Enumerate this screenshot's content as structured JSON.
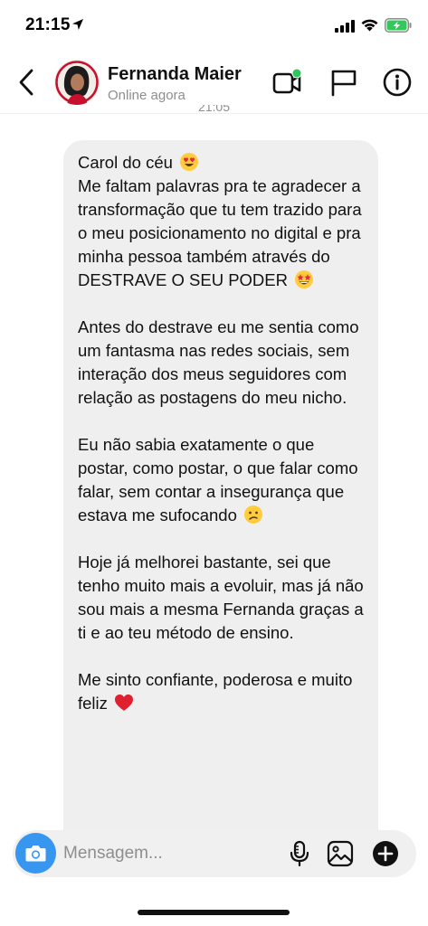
{
  "status_bar": {
    "time": "21:15",
    "icons": [
      "location-arrow-icon",
      "signal-icon",
      "wifi-icon",
      "battery-charging-icon"
    ]
  },
  "header": {
    "contact_name": "Fernanda Maier",
    "contact_status": "Online agora",
    "icons": [
      "back-chevron-icon",
      "avatar",
      "video-call-icon",
      "flag-icon",
      "info-icon"
    ],
    "online_dot_color": "#2ec55a"
  },
  "timestamp": "21:05",
  "message": {
    "paragraphs": [
      {
        "text": "Carol do céu",
        "emoji": "heart-eyes-emoji"
      },
      {
        "text": "Me faltam palavras pra te agradecer a transformação que tu tem trazido para o meu posicionamento no digital e pra minha pessoa também através do DESTRAVE O SEU PODER",
        "emoji": "star-struck-emoji"
      },
      {
        "text": "Antes do destrave eu me sentia como um fantasma nas redes sociais, sem interação dos meus seguidores com relação as postagens do meu nicho."
      },
      {
        "text": "Eu não sabia exatamente o que postar, como postar, o que falar como falar, sem contar a insegurança que estava me sufocando",
        "emoji": "confused-face-emoji"
      },
      {
        "text": "Hoje já melhorei bastante, sei que tenho muito mais a evoluir, mas já não sou mais a mesma Fernanda graças a ti e ao teu método de ensino."
      },
      {
        "text": "Me sinto confiante, poderosa e muito feliz",
        "emoji": "red-heart-emoji"
      }
    ],
    "bubble_color": "#efefef"
  },
  "composer": {
    "placeholder": "Mensagem...",
    "camera_color": "#3797f0",
    "icons": [
      "camera-icon",
      "microphone-icon",
      "gallery-icon",
      "plus-circle-icon"
    ]
  },
  "colors": {
    "accent": "#3797f0",
    "secondary_text": "#8e8e8e",
    "battery_green": "#34c759"
  }
}
